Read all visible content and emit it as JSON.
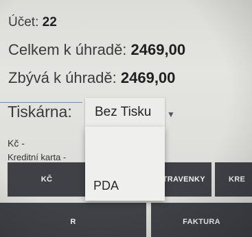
{
  "account": {
    "label": "Účet:",
    "value": "22"
  },
  "total": {
    "label": "Celkem k úhradě:",
    "value": "2469,00"
  },
  "remaining": {
    "label": "Zbývá k úhradě:",
    "value": "2469,00"
  },
  "printer": {
    "label": "Tiskárna:",
    "selected": "Bez Tisku",
    "options": [
      "PDA"
    ]
  },
  "kc_line": "Kč -",
  "card_line": "Kreditní karta -",
  "buttons": {
    "kc": "KČ",
    "stravenky": "STRAVENKY",
    "kre": "KRE",
    "r": "R",
    "faktura": "FAKTURA"
  },
  "colors": {
    "button_bg": "#3f4147",
    "accent_line": "#5a8fd0"
  }
}
